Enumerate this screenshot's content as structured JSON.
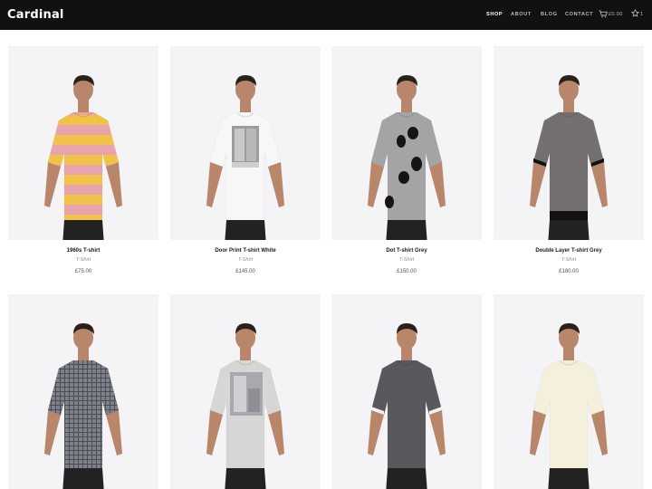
{
  "brand": "Cardinal",
  "nav": [
    {
      "label": "SHOP",
      "active": true
    },
    {
      "label": "ABOUT",
      "active": false
    },
    {
      "label": "BLOG",
      "active": false
    },
    {
      "label": "CONTACT",
      "active": false
    }
  ],
  "cart": {
    "icon": "cart-icon",
    "total": "£0.00"
  },
  "wishlist": {
    "icon": "star-icon",
    "count": "1"
  },
  "products": [
    {
      "name": "1960s T-shirt",
      "category": "T-Shirt",
      "price": "£75.00",
      "shirt_color": "#e8a3ad",
      "design": "stripes"
    },
    {
      "name": "Door Print T-shirt White",
      "category": "T-Shirt",
      "price": "£145.00",
      "shirt_color": "#f7f7f7",
      "design": "doorprint"
    },
    {
      "name": "Dot T-shirt Grey",
      "category": "T-Shirt",
      "price": "£150.00",
      "shirt_color": "#a4a4a6",
      "design": "dots"
    },
    {
      "name": "Double Layer T-shirt Grey",
      "category": "T-Shirt",
      "price": "£180.00",
      "shirt_color": "#747070",
      "design": "doublelayer"
    },
    {
      "name": "",
      "category": "",
      "price": "",
      "shirt_color": "#5d6068",
      "design": "pattern"
    },
    {
      "name": "",
      "category": "",
      "price": "",
      "shirt_color": "#d6d6d4",
      "design": "photoprint"
    },
    {
      "name": "",
      "category": "",
      "price": "",
      "shirt_color": "#59595d",
      "design": "raglan"
    },
    {
      "name": "",
      "category": "",
      "price": "",
      "shirt_color": "#f4f0dc",
      "design": "plain"
    }
  ]
}
